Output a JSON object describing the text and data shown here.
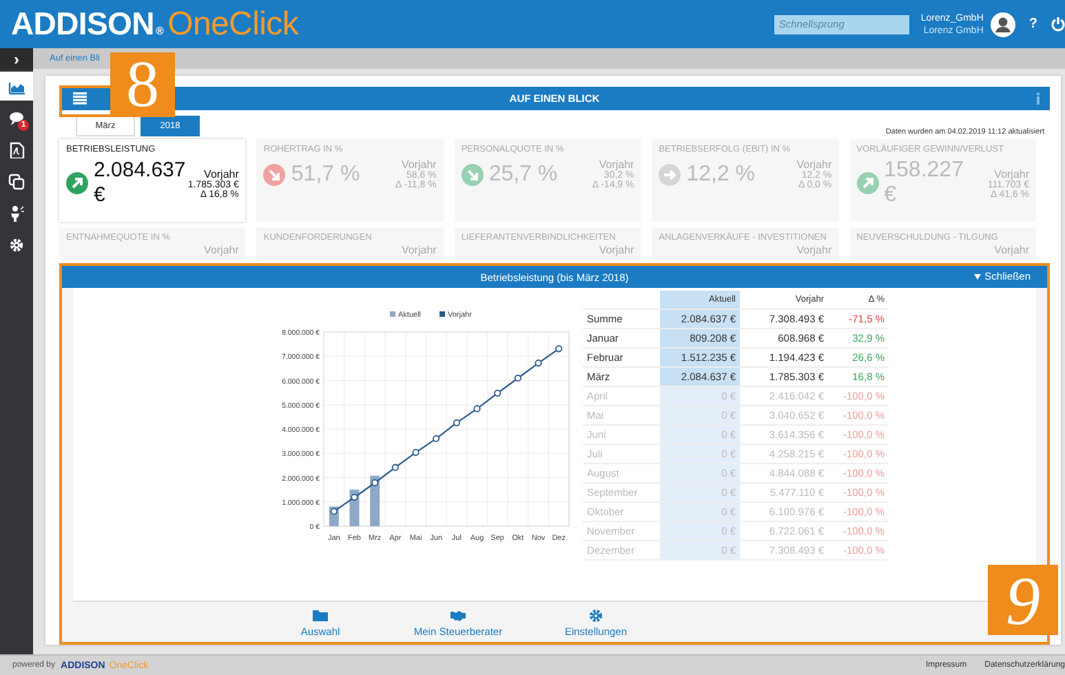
{
  "header": {
    "logo_main": "ADDISON",
    "logo_mark": "®",
    "logo_product": "OneClick",
    "search": {
      "placeholder": "Schnellsprung"
    },
    "user": {
      "name": "Lorenz_GmbH",
      "company": "Lorenz GmbH"
    },
    "help": "?"
  },
  "sidebar": {
    "toggle": "›",
    "items": [
      {
        "selected": true
      },
      {
        "selected": false,
        "badge": "1"
      },
      {
        "selected": false
      },
      {
        "selected": false
      },
      {
        "selected": false
      },
      {
        "selected": false
      }
    ]
  },
  "breadcrumb": "Auf einen Bli",
  "callouts": [
    {
      "number": "8"
    },
    {
      "number": "9"
    }
  ],
  "page": {
    "title": "AUF EINEN BLICK",
    "tabs": [
      {
        "label": "März",
        "selected": false
      },
      {
        "label": "2018",
        "selected": true
      }
    ],
    "updated": "Daten wurden am 04.02.2019 11:12 aktualisiert"
  },
  "kpis": [
    {
      "label": "BETRIEBSLEISTUNG",
      "value": "2.084.637 €",
      "prev_label": "Vorjahr",
      "prev_value": "1.785.303 €",
      "delta": "Δ 16,8 %",
      "kind": "up",
      "color": "#2ea35f",
      "selected": true
    },
    {
      "label": "ROHERTRAG IN %",
      "value": "51,7 %",
      "prev_label": "Vorjahr",
      "prev_value": "58,6 %",
      "delta": "Δ -11,8 %",
      "kind": "down",
      "color": "#f0a1a0",
      "selected": false
    },
    {
      "label": "PERSONALQUOTE IN %",
      "value": "25,7 %",
      "prev_label": "Vorjahr",
      "prev_value": "30,2 %",
      "delta": "Δ -14,9 %",
      "kind": "down",
      "color": "#97d1b0",
      "selected": false
    },
    {
      "label": "BETRIEBSERFOLG (EBIT) IN %",
      "value": "12,2 %",
      "prev_label": "Vorjahr",
      "prev_value": "12,2 %",
      "delta": "Δ 0,0 %",
      "kind": "right",
      "color": "#d6d6d6",
      "selected": false
    },
    {
      "label": "VORLÄUFIGER GEWINN/VERLUST",
      "value": "158.227 €",
      "prev_label": "Vorjahr",
      "prev_value": "111.703 €",
      "delta": "Δ 41,6 %",
      "kind": "up",
      "color": "#97d1b0",
      "selected": false
    }
  ],
  "kpis_row2": [
    {
      "label": "ENTNAHMEQUOTE IN %",
      "prev_label": "Vorjahr"
    },
    {
      "label": "KUNDENFORDERUNGEN",
      "prev_label": "Vorjahr"
    },
    {
      "label": "LIEFERANTENVERBINDLICHKEITEN",
      "prev_label": "Vorjahr"
    },
    {
      "label": "ANLAGENVERKÄUFE - INVESTITIONEN",
      "prev_label": "Vorjahr"
    },
    {
      "label": "NEUVERSCHULDUNG - TILGUNG",
      "prev_label": "Vorjahr"
    }
  ],
  "detail": {
    "title": "Betriebsleistung (bis März 2018)",
    "close": "Schließen",
    "chart_data": {
      "type": "bar",
      "categories": [
        "Jan",
        "Feb",
        "Mrz",
        "Apr",
        "Mai",
        "Jun",
        "Jul",
        "Aug",
        "Sep",
        "Okt",
        "Nov",
        "Dez"
      ],
      "series": [
        {
          "name": "Aktuell",
          "color": "#8ea9c8",
          "values": [
            810000,
            1510000,
            2080000,
            null,
            null,
            null,
            null,
            null,
            null,
            null,
            null,
            null
          ]
        },
        {
          "name": "Vorjahr",
          "type": "line",
          "marker": "circle",
          "color": "#2e5b8e",
          "values": [
            610000,
            1190000,
            1790000,
            2420000,
            3040000,
            3610000,
            4260000,
            4840000,
            5480000,
            6100000,
            6720000,
            7310000
          ]
        }
      ],
      "grid": true,
      "legend": true,
      "ylim": [
        0,
        8000000
      ],
      "yticks": [
        {
          "value": 0,
          "label": "0 €"
        },
        {
          "value": 1000000,
          "label": "1.000.000 €"
        },
        {
          "value": 2000000,
          "label": "2.000.000 €"
        },
        {
          "value": 3000000,
          "label": "3.000.000 €"
        },
        {
          "value": 4000000,
          "label": "4.000.000 €"
        },
        {
          "value": 5000000,
          "label": "5.000.000 €"
        },
        {
          "value": 6000000,
          "label": "6.000.000 €"
        },
        {
          "value": 7000000,
          "label": "7.000.000 €"
        },
        {
          "value": 8000000,
          "label": "8.000.000 €"
        }
      ]
    },
    "table": {
      "columns": [
        "Aktuell",
        "Vorjahr",
        "Δ %"
      ],
      "rows": [
        {
          "name": "Summe",
          "actual": "2.084.637 €",
          "previous": "7.308.493 €",
          "delta": "-71,5 %",
          "positive": false,
          "future": false
        },
        {
          "name": "Januar",
          "actual": "809.208 €",
          "previous": "608.968 €",
          "delta": "32,9 %",
          "positive": true,
          "future": false
        },
        {
          "name": "Februar",
          "actual": "1.512.235 €",
          "previous": "1.194.423 €",
          "delta": "26,6 %",
          "positive": true,
          "future": false
        },
        {
          "name": "März",
          "actual": "2.084.637 €",
          "previous": "1.785.303 €",
          "delta": "16,8 %",
          "positive": true,
          "future": false
        },
        {
          "name": "April",
          "actual": "0 €",
          "previous": "2.416.042 €",
          "delta": "-100,0 %",
          "positive": false,
          "future": true
        },
        {
          "name": "Mai",
          "actual": "0 €",
          "previous": "3.040.652 €",
          "delta": "-100,0 %",
          "positive": false,
          "future": true
        },
        {
          "name": "Juni",
          "actual": "0 €",
          "previous": "3.614.356 €",
          "delta": "-100,0 %",
          "positive": false,
          "future": true
        },
        {
          "name": "Juli",
          "actual": "0 €",
          "previous": "4.258.215 €",
          "delta": "-100,0 %",
          "positive": false,
          "future": true
        },
        {
          "name": "August",
          "actual": "0 €",
          "previous": "4.844.088 €",
          "delta": "-100,0 %",
          "positive": false,
          "future": true
        },
        {
          "name": "September",
          "actual": "0 €",
          "previous": "5.477.110 €",
          "delta": "-100,0 %",
          "positive": false,
          "future": true
        },
        {
          "name": "Oktober",
          "actual": "0 €",
          "previous": "6.100.976 €",
          "delta": "-100,0 %",
          "positive": false,
          "future": true
        },
        {
          "name": "November",
          "actual": "0 €",
          "previous": "6.722.061 €",
          "delta": "-100,0 %",
          "positive": false,
          "future": true
        },
        {
          "name": "Dezember",
          "actual": "0 €",
          "previous": "7.308.493 €",
          "delta": "-100,0 %",
          "positive": false,
          "future": true
        }
      ]
    },
    "nav": [
      {
        "label": "Auswahl"
      },
      {
        "label": "Mein Steuerberater"
      },
      {
        "label": "Einstellungen"
      }
    ]
  },
  "footer": {
    "powered": "powered by",
    "brand_main": "ADDISON",
    "brand_product": "OneClick",
    "links": [
      "Impressum",
      "Datenschutzerklärung"
    ]
  }
}
